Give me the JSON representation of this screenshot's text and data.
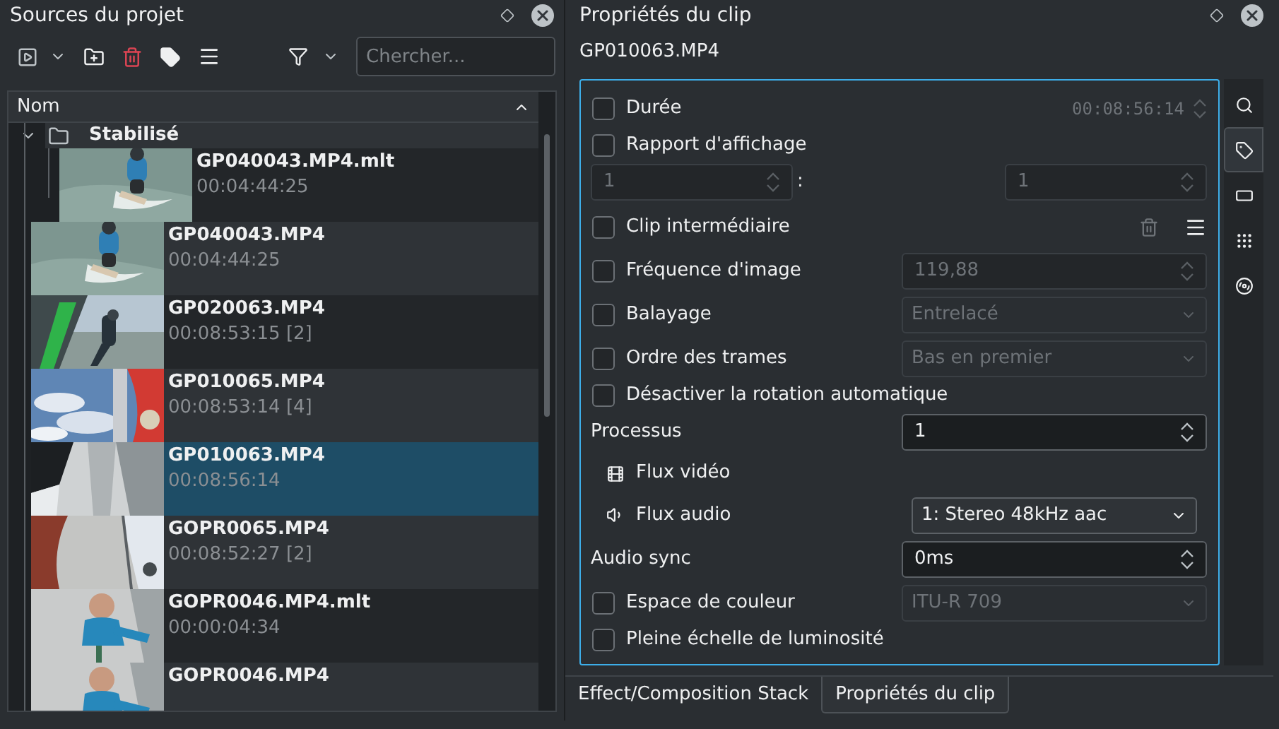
{
  "project_panel": {
    "title": "Sources du projet",
    "search": {
      "placeholder": "Chercher..."
    },
    "column": "Nom",
    "tree": [
      {
        "name": "Stabilisé",
        "kind": "folder",
        "expanded": true,
        "selected": false,
        "children": [
          {
            "name": "GP040043.MP4.mlt",
            "kind": "clip",
            "duration": "00:04:44:25",
            "selected": false
          }
        ]
      },
      {
        "name": "GP040043.MP4",
        "kind": "clip",
        "duration": "00:04:44:25",
        "selected": false
      },
      {
        "name": "GP020063.MP4",
        "kind": "clip",
        "duration": "00:08:53:15 [2]",
        "selected": false
      },
      {
        "name": "GP010065.MP4",
        "kind": "clip",
        "duration": "00:08:53:14 [4]",
        "selected": false
      },
      {
        "name": "GP010063.MP4",
        "kind": "clip",
        "duration": "00:08:56:14",
        "selected": true
      },
      {
        "name": "GOPR0065.MP4",
        "kind": "clip",
        "duration": "00:08:52:27 [2]",
        "selected": false
      },
      {
        "name": "GOPR0046.MP4.mlt",
        "kind": "clip",
        "duration": "00:00:04:34",
        "selected": false
      },
      {
        "name": "GOPR0046.MP4",
        "kind": "clip",
        "selected": false
      }
    ]
  },
  "clip_panel": {
    "title": "Propriétés du clip",
    "clip_name": "GP010063.MP4",
    "properties": [
      {
        "kind": "check",
        "label": "Durée",
        "checked": false,
        "control": {
          "kind": "time",
          "value": "00:08:56:14",
          "disabled": true
        }
      },
      {
        "kind": "check",
        "label": "Rapport d'affichage",
        "checked": false
      },
      {
        "kind": "ratio",
        "separator": ":",
        "values": [
          "1",
          "1"
        ],
        "disabled": true
      },
      {
        "kind": "check",
        "label": "Clip intermédiaire",
        "checked": false,
        "actions": true
      },
      {
        "kind": "check",
        "label": "Fréquence d'image",
        "checked": false,
        "control": {
          "kind": "spin",
          "value": "119,88",
          "disabled": true
        }
      },
      {
        "kind": "check",
        "label": "Balayage",
        "checked": false,
        "control": {
          "kind": "combo",
          "value": "Entrelacé",
          "disabled": true
        }
      },
      {
        "kind": "check",
        "label": "Ordre des trames",
        "checked": false,
        "control": {
          "kind": "combo",
          "value": "Bas en premier",
          "disabled": true
        }
      },
      {
        "kind": "check",
        "label": "Désactiver la rotation automatique",
        "checked": false
      },
      {
        "kind": "field",
        "label": "Processus",
        "control": {
          "kind": "spin",
          "value": "1",
          "disabled": false
        }
      },
      {
        "kind": "video_stream",
        "label": "Flux vidéo"
      },
      {
        "kind": "audio_stream",
        "label": "Flux audio",
        "control": {
          "kind": "combo",
          "value": "1: Stereo 48kHz aac",
          "disabled": false
        }
      },
      {
        "kind": "field",
        "label": "Audio sync",
        "control": {
          "kind": "spin",
          "value": "0ms",
          "disabled": false
        }
      },
      {
        "kind": "check",
        "label": "Espace de couleur",
        "checked": false,
        "control": {
          "kind": "combo",
          "value": "ITU-R 709",
          "disabled": true
        }
      },
      {
        "kind": "check",
        "label": "Pleine échelle de luminosité",
        "checked": false
      }
    ],
    "side_tabs": [
      {
        "kind": "search",
        "selected": false
      },
      {
        "kind": "tag",
        "selected": true
      },
      {
        "kind": "rectangle",
        "selected": false
      },
      {
        "kind": "grid",
        "selected": false
      },
      {
        "kind": "spiral",
        "selected": false
      }
    ]
  },
  "bottom_tabs": [
    {
      "label": "Effect/Composition Stack",
      "selected": false
    },
    {
      "label": "Propriétés du clip",
      "selected": true
    }
  ]
}
